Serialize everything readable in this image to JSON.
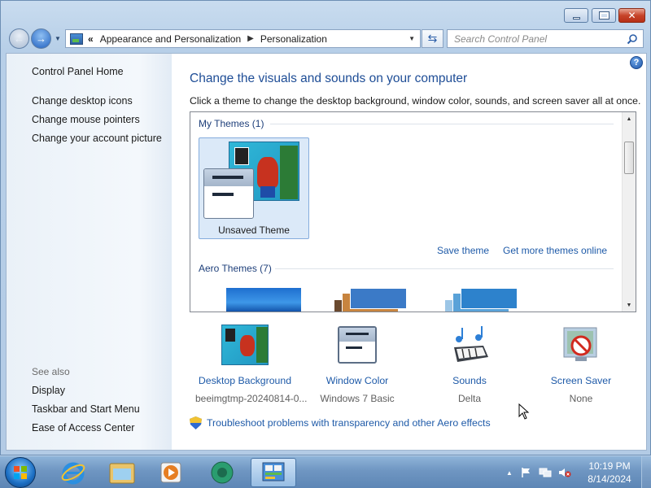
{
  "window": {
    "controls": {
      "min": "minimize",
      "max": "maximize",
      "close": "✕"
    }
  },
  "nav": {
    "back_glyph": "←",
    "fwd_glyph": "→",
    "breadcrumb_overflow": "«",
    "breadcrumb": [
      "Appearance and Personalization",
      "Personalization"
    ],
    "separator": "▶",
    "search_placeholder": "Search Control Panel"
  },
  "left_pane": {
    "home": "Control Panel Home",
    "links": [
      "Change desktop icons",
      "Change mouse pointers",
      "Change your account picture"
    ],
    "see_also_title": "See also",
    "see_also": [
      "Display",
      "Taskbar and Start Menu",
      "Ease of Access Center"
    ]
  },
  "main": {
    "title": "Change the visuals and sounds on your computer",
    "description": "Click a theme to change the desktop background, window color, sounds, and screen saver all at once.",
    "help_glyph": "?",
    "themes": {
      "my_themes_header": "My Themes (1)",
      "selected_theme_name": "Unsaved Theme",
      "save_theme": "Save theme",
      "get_more_online": "Get more themes online",
      "aero_header": "Aero Themes (7)"
    },
    "settings": [
      {
        "label": "Desktop Background",
        "value": "beeimgtmp-20240814-0..."
      },
      {
        "label": "Window Color",
        "value": "Windows 7 Basic"
      },
      {
        "label": "Sounds",
        "value": "Delta"
      },
      {
        "label": "Screen Saver",
        "value": "None"
      }
    ],
    "troubleshoot_link": "Troubleshoot problems with transparency and other Aero effects"
  },
  "taskbar": {
    "time": "10:19 PM",
    "date": "8/14/2024",
    "tray_expand": "▲"
  },
  "colors": {
    "link": "#1e5aa8",
    "heading": "#1e4d96",
    "selection": "#dbe9f8",
    "taskbar": "#6f96c2"
  }
}
